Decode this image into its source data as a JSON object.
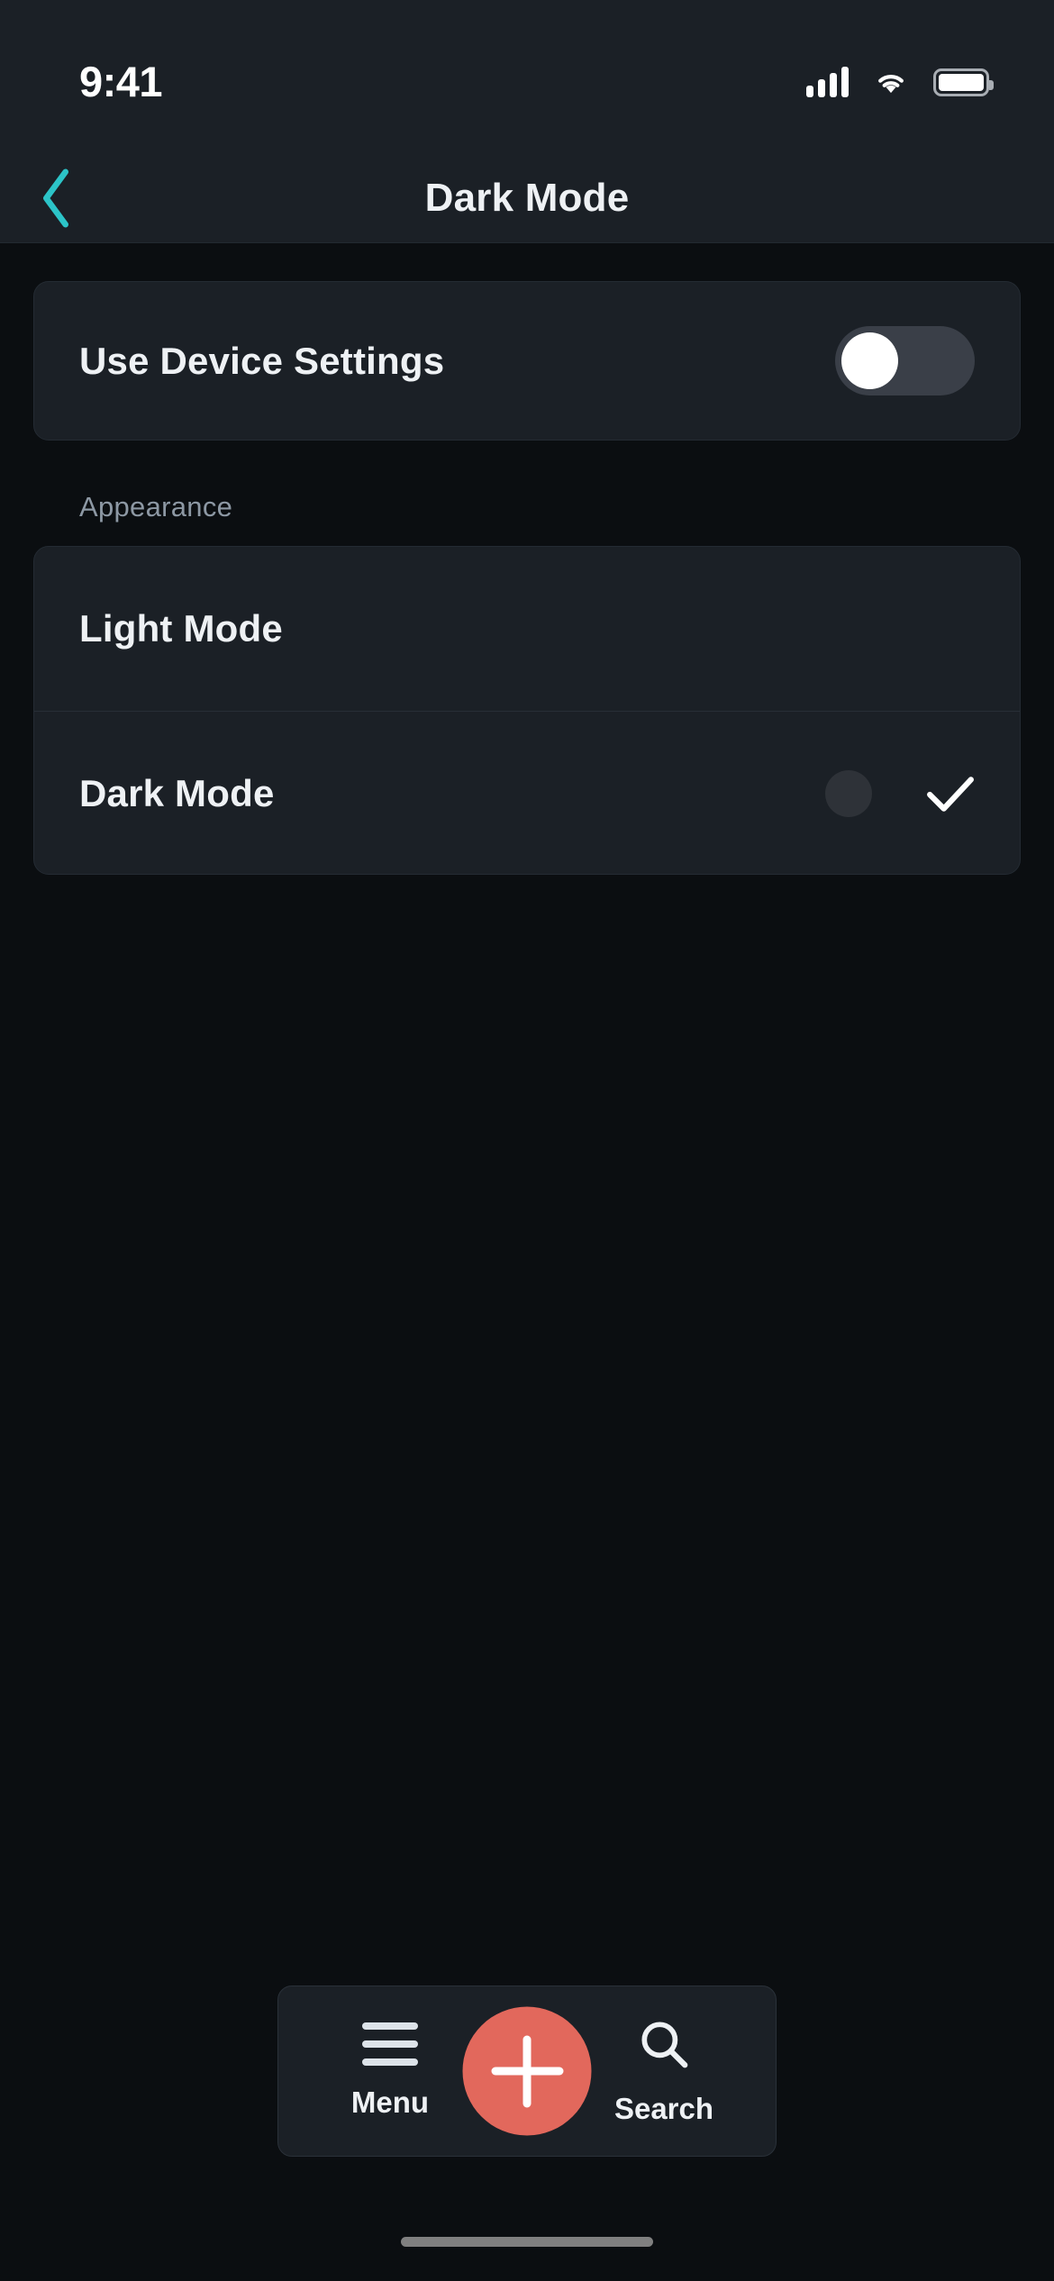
{
  "status_bar": {
    "time": "9:41",
    "cellular_icon": "cellular-signal-icon",
    "wifi_icon": "wifi-icon",
    "battery_icon": "battery-icon"
  },
  "nav": {
    "back_icon": "chevron-left-icon",
    "title": "Dark Mode",
    "back_color": "#2cc4c8"
  },
  "device_settings": {
    "label": "Use Device Settings",
    "toggle_state": "off",
    "toggle_track_color": "#3a3f48",
    "toggle_knob_color": "#ffffff"
  },
  "appearance": {
    "section_label": "Appearance",
    "options": [
      {
        "label": "Light Mode",
        "selected": false,
        "swatch": false
      },
      {
        "label": "Dark Mode",
        "selected": true,
        "swatch": true,
        "swatch_color": "#2e3238"
      }
    ]
  },
  "tab_bar": {
    "menu": {
      "label": "Menu",
      "icon": "hamburger-menu-icon"
    },
    "add": {
      "icon": "plus-icon",
      "color": "#e2685c"
    },
    "search": {
      "label": "Search",
      "icon": "search-icon"
    }
  },
  "theme": {
    "page_background": "#0b0e11",
    "card_background": "#1b2026",
    "primary_text": "#eef1f4",
    "secondary_text": "#8d98a4",
    "accent": "#2cc4c8",
    "home_indicator": "#808080"
  }
}
